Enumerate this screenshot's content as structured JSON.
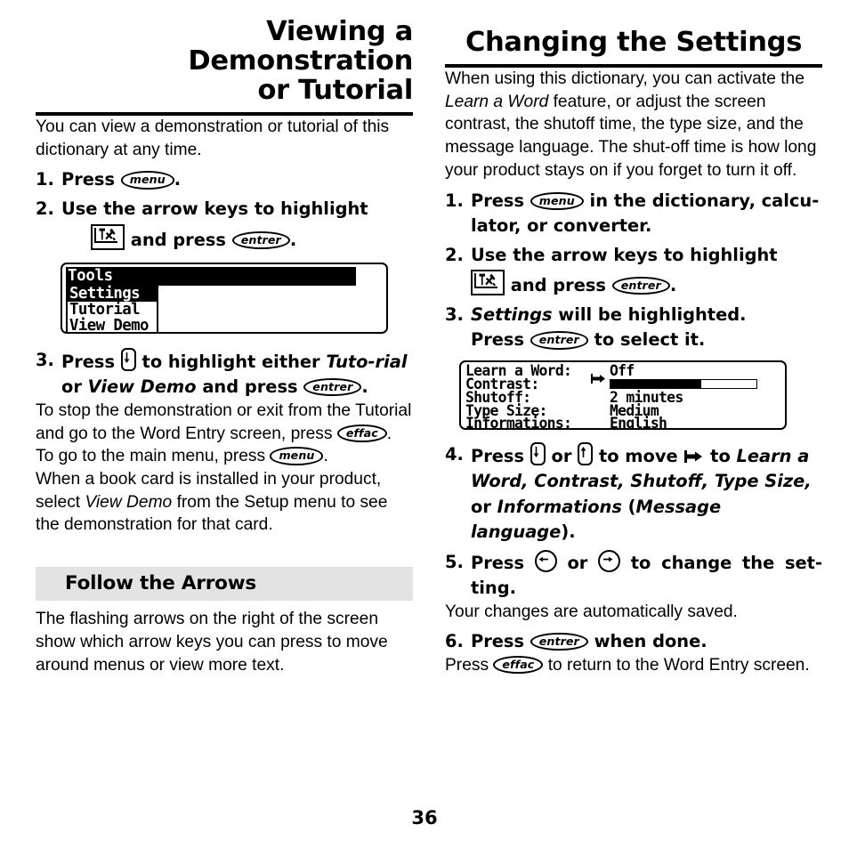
{
  "page": {
    "number": "36",
    "accent_black": "#000000",
    "band_gray": "#e3e3e3"
  },
  "left": {
    "title_line1": "Viewing a Demonstration",
    "title_line2": "or Tutorial",
    "intro": "You can view a demonstration or tutorial of this dictionary at any time.",
    "step1": {
      "num": "1.",
      "text_before": "Press",
      "key": "menu",
      "text_after": "."
    },
    "step2": {
      "num": "2.",
      "line1": "Use the arrow keys to highlight",
      "icon": "tools-icon",
      "text_mid": "and press",
      "key": "entrer",
      "text_after": "."
    },
    "lcd_menu": {
      "title": "Tools",
      "items": [
        {
          "label": "Settings",
          "selected": true
        },
        {
          "label": "Tutorial",
          "selected": false
        },
        {
          "label": "View Demo",
          "selected": false
        }
      ]
    },
    "step3": {
      "num": "3.",
      "text_a": "Press",
      "key_down": "down-arrow-key",
      "text_b": "to highlight either",
      "em1": "Tuto-rial",
      "text_c": "or",
      "em2": "View Demo",
      "text_d": "and press",
      "key": "entrer",
      "text_e": "."
    },
    "sub3a_1": "To stop the demonstration or exit from",
    "sub3a_2": "the Tutorial and go to the Word Entry",
    "sub3a_3_before": "screen,  press",
    "sub3a_key": "effac",
    "sub3a_3_after": ".",
    "sub3b_before": "To go to the main menu, press",
    "sub3b_key": "menu",
    "sub3b_after": ".",
    "bookcard_1": "When a book card is installed in your",
    "bookcard_2_a": "product, select",
    "bookcard_2_em": "View Demo",
    "bookcard_2_b": "from the",
    "bookcard_3": "Setup menu to see the demonstration for",
    "bookcard_4": "that card.",
    "subsection_title": "Follow the Arrows",
    "subsection_body": "The flashing arrows on the right of the screen show which arrow keys you can press to move around menus or view more text."
  },
  "right": {
    "title": "Changing the Settings",
    "intro_a": "When using this dictionary, you can activate the",
    "intro_em": "Learn a Word",
    "intro_b": "feature, or adjust the screen contrast, the shutoff time, the type size, and the message language. The shut-off time is how long your product stays on if you forget to turn it off.",
    "step1": {
      "num": "1.",
      "text_before": "Press",
      "key": "menu",
      "text_after": "in the dictionary, calcu-lator, or converter."
    },
    "step2": {
      "num": "2.",
      "line1": "Use the arrow keys to highlight",
      "icon": "tools-icon",
      "text_mid": "and press",
      "key": "entrer",
      "text_after": "."
    },
    "step3": {
      "num": "3.",
      "em": "Settings",
      "text_a": "will be highlighted.",
      "text_b": "Press",
      "key": "entrer",
      "text_c": "to select it."
    },
    "lcd_settings": {
      "rows": [
        {
          "label": "Learn a Word:",
          "value": "Off",
          "pointer": true,
          "type": "text"
        },
        {
          "label": "Contrast:",
          "value": "",
          "pointer": false,
          "type": "bar",
          "fill_percent": 62
        },
        {
          "label": "Shutoff:",
          "value": "2 minutes",
          "pointer": false,
          "type": "text"
        },
        {
          "label": "Type Size:",
          "value": "Medium",
          "pointer": false,
          "type": "text"
        },
        {
          "label": "Informations:",
          "value": "English",
          "pointer": false,
          "type": "text"
        }
      ]
    },
    "step4": {
      "num": "4.",
      "text_a": "Press",
      "key_down": "down-arrow-key",
      "text_b": "or",
      "key_up": "up-arrow-key",
      "text_c": "to move",
      "flag": "pointer-flag-icon",
      "text_d": "to",
      "em_list": "Learn a Word, Contrast, Shutoff, Type Size,",
      "text_e": "or",
      "em_last": "Informations",
      "text_f": "(",
      "em_paren": "Message language",
      "text_g": ")."
    },
    "step5": {
      "num": "5.",
      "text_a": "Press",
      "key_left": "left-arrow-key",
      "text_b": "or",
      "key_right": "right-arrow-key",
      "text_c": "to change the set-ting."
    },
    "sub5": "Your changes are automatically saved.",
    "step6": {
      "num": "6.",
      "text_a": "Press",
      "key": "entrer",
      "text_b": "when done."
    },
    "sub6_a": "Press",
    "sub6_key": "effac",
    "sub6_b": "to return to the Word Entry screen."
  }
}
